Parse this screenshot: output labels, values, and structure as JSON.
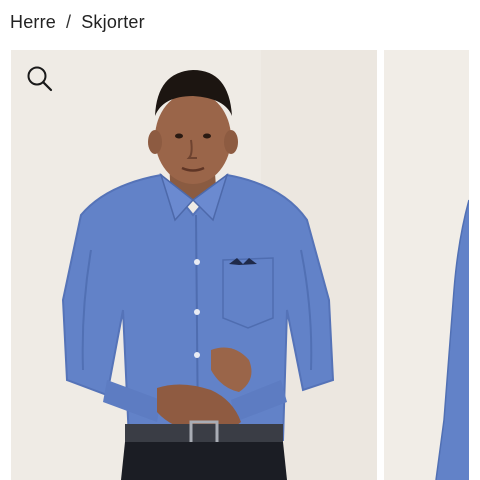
{
  "breadcrumb": {
    "items": [
      {
        "label": "Herre"
      },
      {
        "label": "Skjorter"
      }
    ],
    "separator": "/"
  },
  "gallery": {
    "zoom_icon": "search-icon",
    "images": [
      {
        "name": "product-image-front"
      },
      {
        "name": "product-image-next"
      }
    ]
  },
  "colors": {
    "background": "#efebe5",
    "shirt": "#5f7fc7",
    "trousers": "#1b1d24",
    "belt": "#3a3d45"
  }
}
